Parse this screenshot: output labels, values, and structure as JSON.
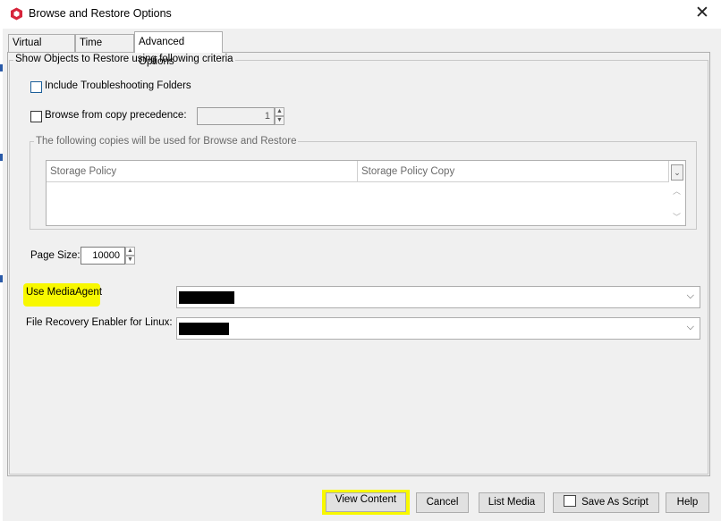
{
  "window": {
    "title": "Browse and Restore Options",
    "close_glyph": "✕"
  },
  "tabs": [
    {
      "label": "Virtual Server"
    },
    {
      "label": "Time Range"
    },
    {
      "label": "Advanced Options",
      "active": true
    }
  ],
  "criteria": {
    "legend": "Show Objects to Restore using following criteria",
    "include_troubleshooting": {
      "label": "Include Troubleshooting Folders",
      "checked": false
    },
    "browse_copy_precedence": {
      "label": "Browse from copy precedence:",
      "checked": false,
      "value": "1"
    },
    "copies": {
      "legend": "The following copies will be used for Browse and Restore",
      "columns": [
        "Storage Policy",
        "Storage Policy Copy"
      ],
      "rows": []
    },
    "page_size": {
      "label": "Page Size:",
      "value": "10000"
    },
    "media_agent": {
      "label": "Use MediaAgent",
      "value": ""
    },
    "file_recovery": {
      "label": "File Recovery Enabler for Linux:",
      "value": ""
    }
  },
  "buttons": {
    "view_content": "View Content",
    "cancel": "Cancel",
    "list_media": "List Media",
    "save_as_script": "Save As Script",
    "help": "Help"
  },
  "colors": {
    "highlight": "#f8f800",
    "redaction": "#000000"
  },
  "icons": [
    "app-logo-icon",
    "close-icon",
    "chevron-down-icon",
    "script-icon",
    "column-menu-icon"
  ]
}
